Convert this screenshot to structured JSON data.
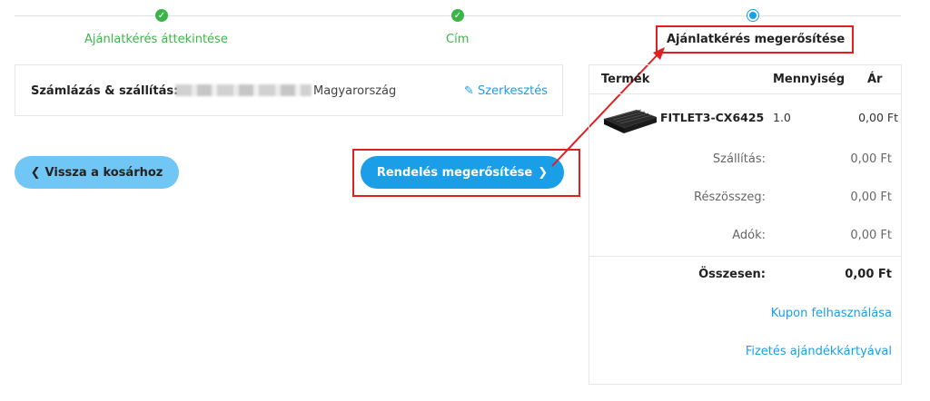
{
  "stepper": {
    "steps": [
      {
        "label": "Ajánlatkérés áttekintése",
        "state": "done"
      },
      {
        "label": "Cím",
        "state": "done"
      },
      {
        "label": "Ajánlatkérés megerősítése",
        "state": "current"
      }
    ]
  },
  "billing": {
    "label": "Számlázás & szállítás:",
    "country": "Magyarország",
    "edit_label": "Szerkesztés"
  },
  "actions": {
    "back_label": "Vissza a kosárhoz",
    "confirm_label": "Rendelés megerősítése"
  },
  "summary": {
    "columns": {
      "product": "Termék",
      "quantity": "Mennyiség",
      "price": "Ár"
    },
    "product": {
      "name": "FITLET3-CX6425",
      "quantity": "1.0",
      "price": "0,00 Ft"
    },
    "rows": [
      {
        "label": "Szállítás:",
        "value": "0,00 Ft"
      },
      {
        "label": "Részösszeg:",
        "value": "0,00 Ft"
      },
      {
        "label": "Adók:",
        "value": "0,00 Ft"
      }
    ],
    "total": {
      "label": "Összesen:",
      "value": "0,00 Ft"
    },
    "links": {
      "coupon": "Kupon felhasználása",
      "gift_card": "Fizetés ajándékkártyával"
    }
  },
  "colors": {
    "step_done": "#3bb54a",
    "accent": "#1a9ee8",
    "back_button": "#70c6f5",
    "annotation": "#e02020"
  }
}
